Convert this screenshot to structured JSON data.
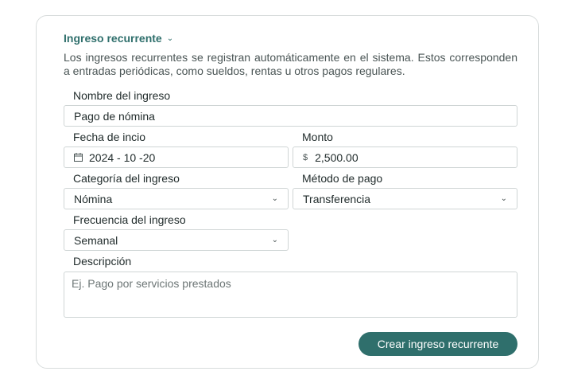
{
  "form": {
    "title": "Ingreso recurrente",
    "description": "Los ingresos recurrentes se registran automáticamente en el sistema. Estos corresponden a entradas periódicas, como sueldos, rentas u otros pagos regulares.",
    "name_label": "Nombre del ingreso",
    "name_value": "Pago de nómina",
    "date_label": "Fecha de incio",
    "date_value": "2024 - 10 -20",
    "amount_label": "Monto",
    "amount_prefix": "$",
    "amount_value": "2,500.00",
    "category_label": "Categoría del ingreso",
    "category_value": "Nómina",
    "method_label": "Método de pago",
    "method_value": "Transferencia",
    "frequency_label": "Frecuencia del ingreso",
    "frequency_value": "Semanal",
    "description_label": "Descripción",
    "description_placeholder": "Ej. Pago por servicios prestados",
    "submit_label": "Crear ingreso recurrente",
    "chevron_glyph": "⌄"
  },
  "colors": {
    "accent": "#2f6f6c",
    "border": "#cfd5d5",
    "text": "#1f2a2a"
  }
}
